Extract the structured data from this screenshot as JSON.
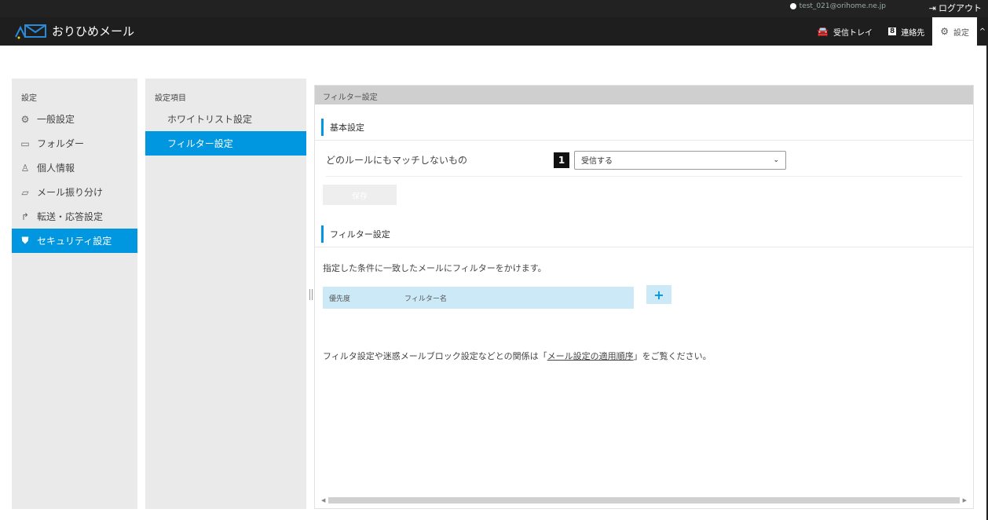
{
  "topbar": {
    "account": "test_021@orihome.ne.jp",
    "logout_label": "ログアウト"
  },
  "header": {
    "logo_text": "おりひめメール",
    "nav": [
      {
        "label": "受信トレイ",
        "icon": "mail-car-icon"
      },
      {
        "label": "連絡先",
        "icon": "contacts-icon"
      },
      {
        "label": "設定",
        "icon": "gear-icon"
      }
    ]
  },
  "sidebar": {
    "heading": "設定",
    "items": [
      {
        "label": "一般設定",
        "icon": "gear-icon"
      },
      {
        "label": "フォルダー",
        "icon": "folder-icon"
      },
      {
        "label": "個人情報",
        "icon": "person-icon"
      },
      {
        "label": "メール振り分け",
        "icon": "folder-open-icon"
      },
      {
        "label": "転送・応答設定",
        "icon": "forward-icon"
      },
      {
        "label": "セキュリティ設定",
        "icon": "shield-icon"
      }
    ]
  },
  "subnav": {
    "heading": "設定項目",
    "items": [
      {
        "label": "ホワイトリスト設定"
      },
      {
        "label": "フィルター設定"
      }
    ]
  },
  "main": {
    "title": "フィルター設定",
    "basic": {
      "section_title": "基本設定",
      "unmatched_label": "どのルールにもマッチしないもの",
      "badge": "1",
      "select_value": "受信する",
      "save_label": "保存"
    },
    "filter": {
      "section_title": "フィルター設定",
      "description": "指定した条件に一致したメールにフィルターをかけます。",
      "col_priority": "優先度",
      "col_name": "フィルター名",
      "add_label": "+"
    },
    "note_prefix": "フィルタ設定や迷惑メールブロック設定などとの関係は「",
    "note_link": "メール設定の適用順序",
    "note_suffix": "」をご覧ください。"
  },
  "colors": {
    "accent": "#0096e0",
    "header_bg": "#1e1e1e",
    "table_header_bg": "#cbe9f6"
  }
}
